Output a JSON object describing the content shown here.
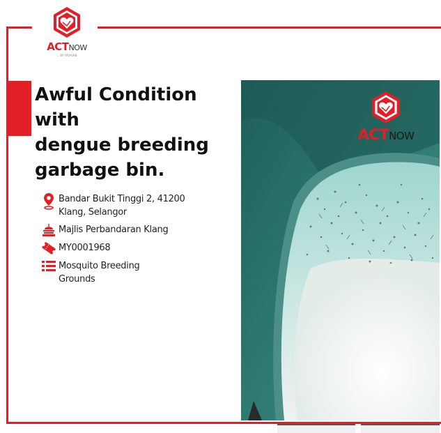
{
  "brand": {
    "logo_act": "ACT",
    "logo_now": "NOW",
    "tagline": "... BY YAYASAN",
    "accent_color": "#e21f26"
  },
  "report": {
    "title": "Awful Condition with\ndengue breeding\ngarbage bin.",
    "address": "Bandar Bukit Tinggi 2, 41200\nKlang, Selangor",
    "authority": "Majlis Perbandaran Klang",
    "report_id": "MY0001968",
    "category": "Mosquito Breeding\nGrounds"
  },
  "icons": {
    "address": "location-pin-icon",
    "authority": "government-building-icon",
    "report_id": "ticket-icon",
    "category": "list-icon"
  },
  "photo": {
    "watermark_act": "ACT",
    "watermark_now": "NOW"
  }
}
